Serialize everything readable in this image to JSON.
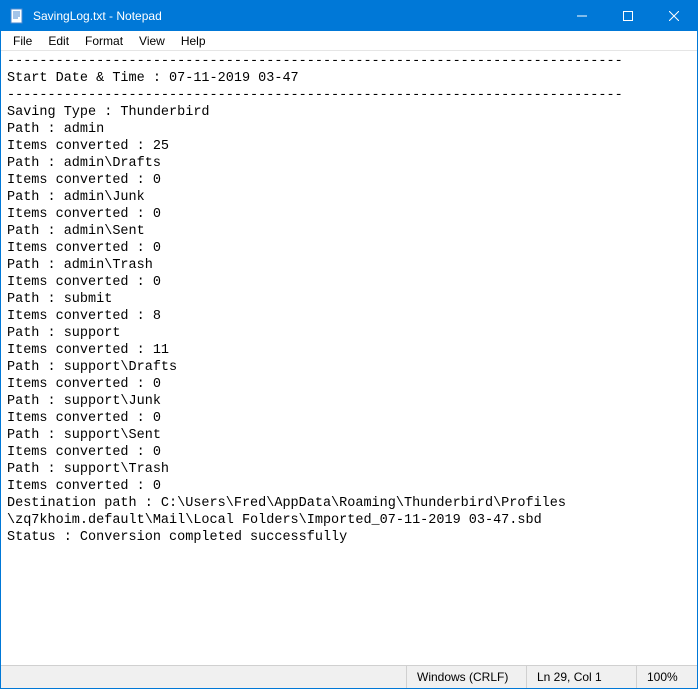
{
  "titlebar": {
    "title": "SavingLog.txt - Notepad"
  },
  "menubar": {
    "file": "File",
    "edit": "Edit",
    "format": "Format",
    "view": "View",
    "help": "Help"
  },
  "document": {
    "text": "----------------------------------------------------------------------------\nStart Date & Time : 07-11-2019 03-47\n----------------------------------------------------------------------------\nSaving Type : Thunderbird\nPath : admin\nItems converted : 25\nPath : admin\\Drafts\nItems converted : 0\nPath : admin\\Junk\nItems converted : 0\nPath : admin\\Sent\nItems converted : 0\nPath : admin\\Trash\nItems converted : 0\nPath : submit\nItems converted : 8\nPath : support\nItems converted : 11\nPath : support\\Drafts\nItems converted : 0\nPath : support\\Junk\nItems converted : 0\nPath : support\\Sent\nItems converted : 0\nPath : support\\Trash\nItems converted : 0\nDestination path : C:\\Users\\Fred\\AppData\\Roaming\\Thunderbird\\Profiles\n\\zq7khoim.default\\Mail\\Local Folders\\Imported_07-11-2019 03-47.sbd\nStatus : Conversion completed successfully"
  },
  "statusbar": {
    "encoding": "Windows (CRLF)",
    "position": "Ln 29, Col 1",
    "zoom": "100%"
  }
}
